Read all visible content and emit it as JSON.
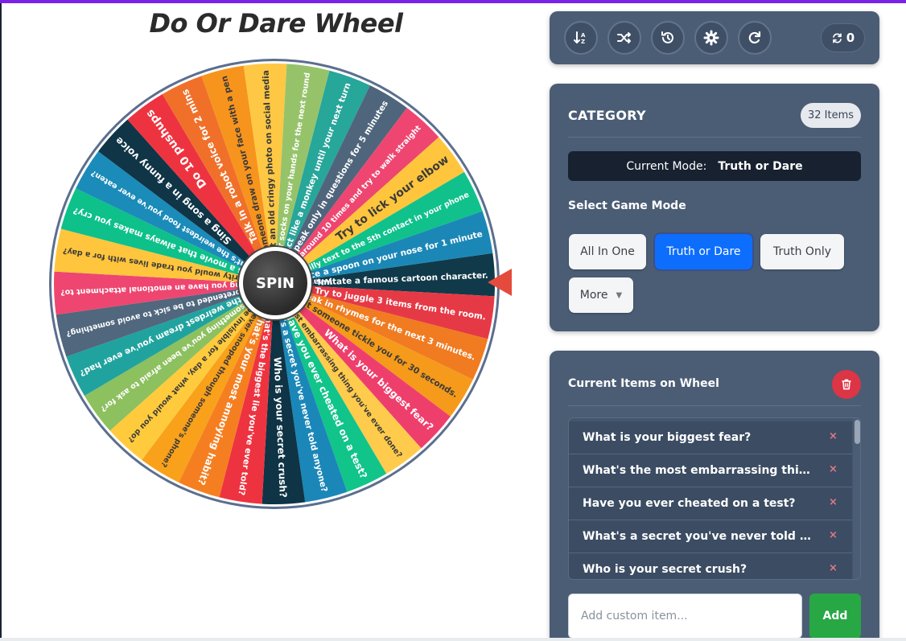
{
  "app": {
    "title": "Do Or Dare Wheel"
  },
  "wheel": {
    "spin_label": "SPIN",
    "rim_color": "#5b6f8e",
    "segments": [
      {
        "text": "Imitate a famous cartoon character.",
        "color": "#103a4a"
      },
      {
        "text": "Try to juggle 3 items from the room.",
        "color": "#e63946"
      },
      {
        "text": "Speak in rhymes for the next 3 minutes.",
        "color": "#f07b21"
      },
      {
        "text": "Let someone tickle you for 30 seconds.",
        "color": "#f59a1a"
      },
      {
        "text": "What is your biggest fear?",
        "color": "#ee3f6c"
      },
      {
        "text": "What's the most embarrassing thing you've ever done?",
        "color": "#ffcb4c"
      },
      {
        "text": "Have you ever cheated on a test?",
        "color": "#11c48a"
      },
      {
        "text": "What's a secret you've never told anyone?",
        "color": "#1a87b8"
      },
      {
        "text": "Who is your secret crush?",
        "color": "#0e3446"
      },
      {
        "text": "What's the biggest lie you've ever told?",
        "color": "#ee3340"
      },
      {
        "text": "What's your most annoying habit?",
        "color": "#f57f20"
      },
      {
        "text": "Have you ever snooped through someone's phone?",
        "color": "#f9a11b"
      },
      {
        "text": "If you could be invisible for a day, what would you do?",
        "color": "#ffcb3d"
      },
      {
        "text": "What's something you've been afraid to ask for?",
        "color": "#8dc05f"
      },
      {
        "text": "What's the weirdest dream you've ever had?",
        "color": "#20a39e"
      },
      {
        "text": "Have you ever pretended to be sick to avoid something?",
        "color": "#50677d"
      },
      {
        "text": "What's the silliest thing you have an emotional attachment to?",
        "color": "#ee4670"
      },
      {
        "text": "Which celebrity would you trade lives with for a day?",
        "color": "#ffc53d"
      },
      {
        "text": "What's a movie that always makes you cry?",
        "color": "#0ec08a"
      },
      {
        "text": "What's the weirdest food you've ever eaten?",
        "color": "#1b8bb9"
      },
      {
        "text": "Sing a song in a funny voice",
        "color": "#0f3547"
      },
      {
        "text": "Do 10 pushups",
        "color": "#ee3340"
      },
      {
        "text": "Talk in a robot voice for 2 mins",
        "color": "#f0702a"
      },
      {
        "text": "Let someone draw on your face with a pen",
        "color": "#f7941d"
      },
      {
        "text": "Post an old cringy photo on social media",
        "color": "#ffc844"
      },
      {
        "text": "Wear socks on your hands for the next round",
        "color": "#96c36a"
      },
      {
        "text": "Act like a monkey until your next turn",
        "color": "#27a69a"
      },
      {
        "text": "Speak only in questions for 5 minutes",
        "color": "#4f657c"
      },
      {
        "text": "Spin around 10 times and try to walk straight",
        "color": "#ee4670"
      },
      {
        "text": "Try to lick your elbow",
        "color": "#ffc53d"
      },
      {
        "text": "Send a silly text to the 5th contact in your phone",
        "color": "#10c18b"
      },
      {
        "text": "Balance a spoon on your nose for 1 minute",
        "color": "#1b87b6"
      }
    ]
  },
  "toolbar": {
    "buttons": [
      {
        "icon": "sort-icon"
      },
      {
        "icon": "shuffle-icon"
      },
      {
        "icon": "history-icon"
      },
      {
        "icon": "gear-icon"
      },
      {
        "icon": "reset-icon"
      }
    ],
    "spin_count": "0"
  },
  "category": {
    "title": "CATEGORY",
    "items_badge": "32 Items",
    "current_mode_label": "Current Mode:",
    "current_mode_value": "Truth or Dare",
    "select_label": "Select Game Mode",
    "modes": [
      "All In One",
      "Truth or Dare",
      "Truth Only",
      "More"
    ],
    "active_mode": "Truth or Dare"
  },
  "items": {
    "title": "Current Items on Wheel",
    "list": [
      "What is your biggest fear?",
      "What's the most embarrassing thing you've ever done?",
      "Have you ever cheated on a test?",
      "What's a secret you've never told anyone?",
      "Who is your secret crush?"
    ],
    "remove_label": "×",
    "add_placeholder": "Add custom item...",
    "add_button": "Add"
  }
}
